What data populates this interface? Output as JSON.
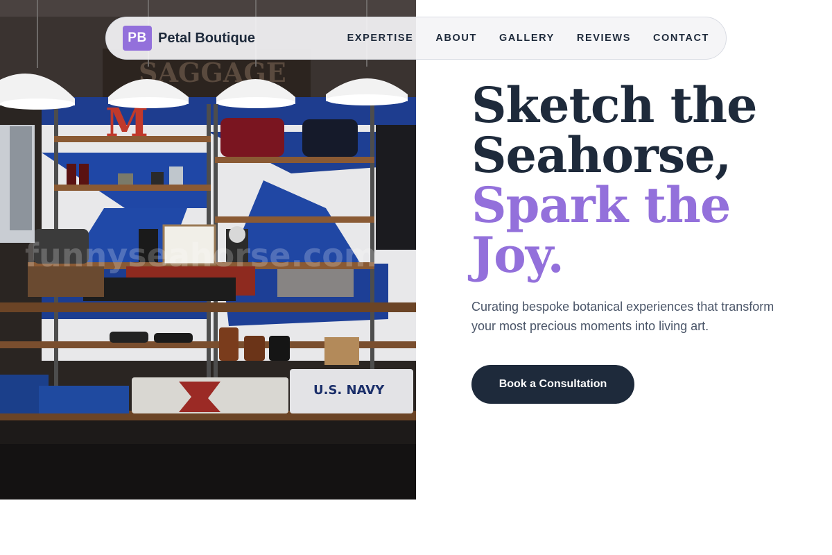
{
  "brand": {
    "mark": "PB",
    "name": "Petal Boutique"
  },
  "nav": {
    "items": [
      {
        "label": "EXPERTISE"
      },
      {
        "label": "ABOUT"
      },
      {
        "label": "GALLERY"
      },
      {
        "label": "REVIEWS"
      },
      {
        "label": "CONTACT"
      }
    ]
  },
  "hero": {
    "headline_line1": "Sketch the",
    "headline_line2": "Seahorse,",
    "headline_accent_line1": "Spark the",
    "headline_accent_line2": "Joy.",
    "subtitle": "Curating bespoke botanical experiences that transform your most precious moments into living art.",
    "cta_label": "Book a Consultation"
  },
  "photo": {
    "letter_sign": "M",
    "banner_text": "SAGGAGE",
    "shirt_text": "U.S. NAVY",
    "watermark": "funnyseahorse.com"
  },
  "colors": {
    "accent": "#9370db",
    "dark": "#1e2a3b",
    "body_text": "#4a5568",
    "background": "#ffffff"
  }
}
